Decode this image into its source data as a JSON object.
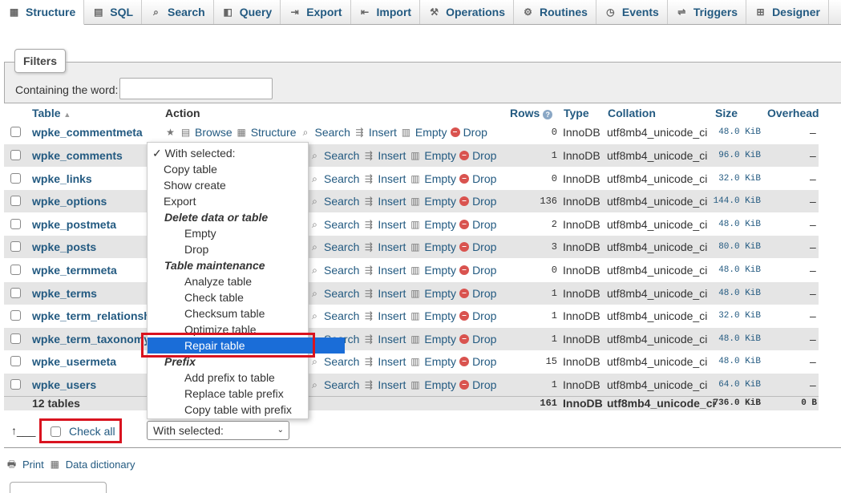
{
  "tabs": [
    {
      "label": "Structure",
      "icon": "structure-icon"
    },
    {
      "label": "SQL",
      "icon": "sql-icon"
    },
    {
      "label": "Search",
      "icon": "search-icon"
    },
    {
      "label": "Query",
      "icon": "query-icon"
    },
    {
      "label": "Export",
      "icon": "export-icon"
    },
    {
      "label": "Import",
      "icon": "import-icon"
    },
    {
      "label": "Operations",
      "icon": "wrench-icon"
    },
    {
      "label": "Routines",
      "icon": "routines-icon"
    },
    {
      "label": "Events",
      "icon": "clock-icon"
    },
    {
      "label": "Triggers",
      "icon": "triggers-icon"
    },
    {
      "label": "Designer",
      "icon": "designer-icon"
    }
  ],
  "filters": {
    "legend": "Filters",
    "label": "Containing the word:",
    "value": ""
  },
  "headers": {
    "table": "Table",
    "action": "Action",
    "rows": "Rows",
    "type": "Type",
    "collation": "Collation",
    "size": "Size",
    "overhead": "Overhead"
  },
  "actions": {
    "browse": "Browse",
    "structure": "Structure",
    "search": "Search",
    "insert": "Insert",
    "empty": "Empty",
    "drop": "Drop"
  },
  "tables": [
    {
      "name": "wpke_commentmeta",
      "rows": "0",
      "type": "InnoDB",
      "collation": "utf8mb4_unicode_ci",
      "size": "48.0 KiB",
      "overhead": "–"
    },
    {
      "name": "wpke_comments",
      "rows": "1",
      "type": "InnoDB",
      "collation": "utf8mb4_unicode_ci",
      "size": "96.0 KiB",
      "overhead": "–"
    },
    {
      "name": "wpke_links",
      "rows": "0",
      "type": "InnoDB",
      "collation": "utf8mb4_unicode_ci",
      "size": "32.0 KiB",
      "overhead": "–"
    },
    {
      "name": "wpke_options",
      "rows": "136",
      "type": "InnoDB",
      "collation": "utf8mb4_unicode_ci",
      "size": "144.0 KiB",
      "overhead": "–"
    },
    {
      "name": "wpke_postmeta",
      "rows": "2",
      "type": "InnoDB",
      "collation": "utf8mb4_unicode_ci",
      "size": "48.0 KiB",
      "overhead": "–"
    },
    {
      "name": "wpke_posts",
      "rows": "3",
      "type": "InnoDB",
      "collation": "utf8mb4_unicode_ci",
      "size": "80.0 KiB",
      "overhead": "–"
    },
    {
      "name": "wpke_termmeta",
      "rows": "0",
      "type": "InnoDB",
      "collation": "utf8mb4_unicode_ci",
      "size": "48.0 KiB",
      "overhead": "–"
    },
    {
      "name": "wpke_terms",
      "rows": "1",
      "type": "InnoDB",
      "collation": "utf8mb4_unicode_ci",
      "size": "48.0 KiB",
      "overhead": "–"
    },
    {
      "name": "wpke_term_relationshi",
      "rows": "1",
      "type": "InnoDB",
      "collation": "utf8mb4_unicode_ci",
      "size": "32.0 KiB",
      "overhead": "–"
    },
    {
      "name": "wpke_term_taxonomy",
      "rows": "1",
      "type": "InnoDB",
      "collation": "utf8mb4_unicode_ci",
      "size": "48.0 KiB",
      "overhead": "–"
    },
    {
      "name": "wpke_usermeta",
      "rows": "15",
      "type": "InnoDB",
      "collation": "utf8mb4_unicode_ci",
      "size": "48.0 KiB",
      "overhead": "–"
    },
    {
      "name": "wpke_users",
      "rows": "1",
      "type": "InnoDB",
      "collation": "utf8mb4_unicode_ci",
      "size": "64.0 KiB",
      "overhead": "–"
    }
  ],
  "footer": {
    "count": "12 tables",
    "rows": "161",
    "type": "InnoDB",
    "collation": "utf8mb4_unicode_ci",
    "size": "736.0 KiB",
    "overhead": "0 B"
  },
  "menu": {
    "header": "✓ With selected:",
    "items": [
      {
        "label": "Copy table",
        "kind": "l1"
      },
      {
        "label": "Show create",
        "kind": "l1"
      },
      {
        "label": "Export",
        "kind": "l1"
      },
      {
        "label": "Delete data or table",
        "kind": "grp"
      },
      {
        "label": "Empty",
        "kind": "l2"
      },
      {
        "label": "Drop",
        "kind": "l2"
      },
      {
        "label": "Table maintenance",
        "kind": "grp"
      },
      {
        "label": "Analyze table",
        "kind": "l2"
      },
      {
        "label": "Check table",
        "kind": "l2"
      },
      {
        "label": "Checksum table",
        "kind": "l2"
      },
      {
        "label": "Optimize table",
        "kind": "l2"
      },
      {
        "label": "Repair table",
        "kind": "l2",
        "selected": true
      },
      {
        "label": "Prefix",
        "kind": "grp"
      },
      {
        "label": "Add prefix to table",
        "kind": "l2"
      },
      {
        "label": "Replace table prefix",
        "kind": "l2"
      },
      {
        "label": "Copy table with prefix",
        "kind": "l2"
      }
    ]
  },
  "bottom": {
    "check_all": "Check all",
    "with_selected": "With selected:",
    "print": "Print",
    "data_dictionary": "Data dictionary"
  },
  "colors": {
    "link": "#235a81",
    "row_alt": "#e5e5e5",
    "highlight": "#1a6dd8",
    "annotation": "#d9131f"
  }
}
